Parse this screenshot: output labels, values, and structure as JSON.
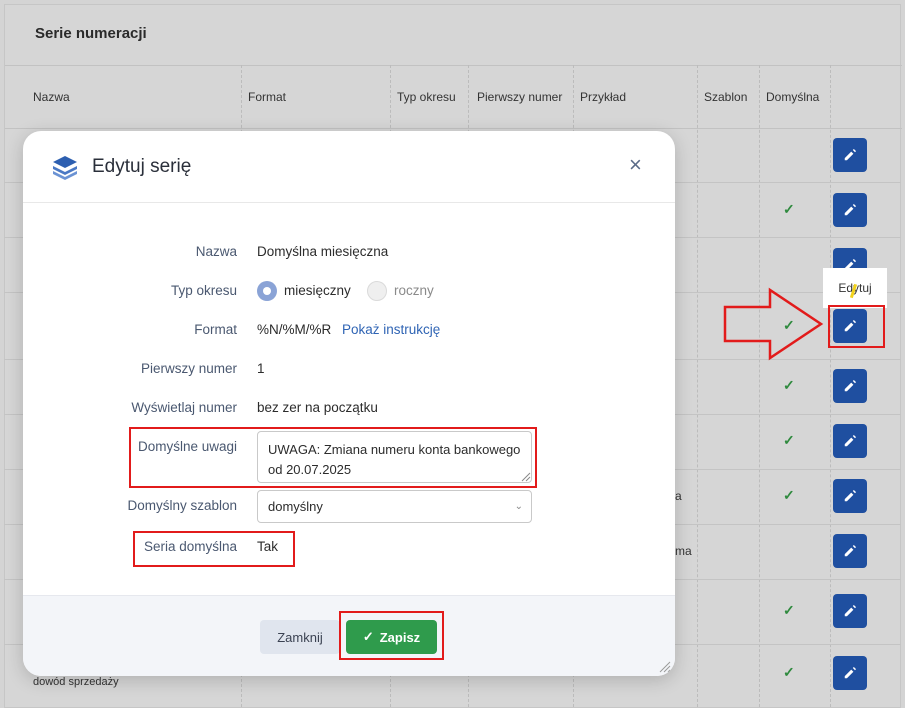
{
  "page": {
    "title": "Serie numeracji",
    "columns": [
      "Nazwa",
      "Format",
      "Typ okresu",
      "Pierwszy numer",
      "Przykład",
      "Szablon",
      "Domyślna"
    ],
    "rows": [
      {
        "default": false
      },
      {
        "default": true
      },
      {
        "default": false
      },
      {
        "default": true
      },
      {
        "default": true
      },
      {
        "default": true
      },
      {
        "default": true
      },
      {
        "default": false
      },
      {
        "default": true
      },
      {
        "default": true
      }
    ],
    "fragments": {
      "row7_example": "a",
      "row8_example": "ma",
      "last_row_name": "dowód sprzedaży"
    },
    "tooltip": "Edytuj"
  },
  "modal": {
    "title": "Edytuj serię",
    "close_icon": "×",
    "fields": {
      "name_label": "Nazwa",
      "name_value": "Domyślna miesięczna",
      "period_label": "Typ okresu",
      "period_option_monthly": "miesięczny",
      "period_option_yearly": "roczny",
      "period_selected": "miesięczny",
      "format_label": "Format",
      "format_value": "%N/%M/%R",
      "format_link": "Pokaż instrukcję",
      "first_number_label": "Pierwszy numer",
      "first_number_value": "1",
      "display_number_label": "Wyświetlaj numer",
      "display_number_value": "bez zer na początku",
      "notes_label": "Domyślne uwagi",
      "notes_value": "UWAGA: Zmiana numeru konta bankowego od 20.07.2025",
      "template_label": "Domyślny szablon",
      "template_value": "domyślny",
      "default_series_label": "Seria domyślna",
      "default_series_value": "Tak"
    },
    "buttons": {
      "close": "Zamknij",
      "save": "Zapisz"
    }
  },
  "colors": {
    "primary_button": "#1f4fa0",
    "save_button": "#2f9b4c",
    "highlight": "#e21b1b",
    "check": "#2f8a3e",
    "link": "#2f64b4"
  },
  "icons": [
    "layers-icon",
    "close-icon",
    "edit-icon",
    "check-icon",
    "chevron-down-icon",
    "resize-handle-icon",
    "arrow-right-icon"
  ]
}
